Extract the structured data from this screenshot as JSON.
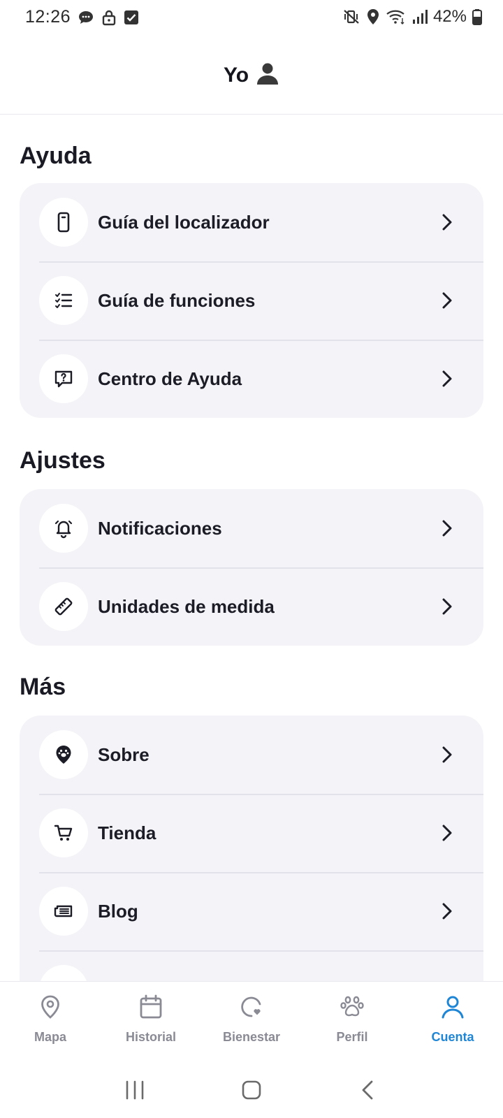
{
  "status_bar": {
    "time": "12:26",
    "battery_percent": "42%",
    "icons_left": [
      "chat-icon",
      "lock-icon",
      "check-box-icon"
    ],
    "icons_right": [
      "mute-vibrate-icon",
      "location-icon",
      "wifi-icon",
      "signal-icon",
      "battery-icon"
    ]
  },
  "header": {
    "title": "Yo",
    "icon": "person-icon"
  },
  "sections": {
    "help": {
      "title": "Ayuda",
      "items": [
        {
          "label": "Guía del localizador",
          "icon": "device-icon"
        },
        {
          "label": "Guía de funciones",
          "icon": "checklist-icon"
        },
        {
          "label": "Centro de Ayuda",
          "icon": "help-chat-icon"
        }
      ]
    },
    "settings": {
      "title": "Ajustes",
      "items": [
        {
          "label": "Notificaciones",
          "icon": "bell-icon"
        },
        {
          "label": "Unidades de medida",
          "icon": "ruler-icon"
        }
      ]
    },
    "more": {
      "title": "Más",
      "items": [
        {
          "label": "Sobre",
          "icon": "paw-pin-icon"
        },
        {
          "label": "Tienda",
          "icon": "cart-icon"
        },
        {
          "label": "Blog",
          "icon": "newspaper-icon"
        }
      ]
    }
  },
  "bottom_nav": {
    "items": [
      {
        "label": "Mapa",
        "icon": "map-pin-icon"
      },
      {
        "label": "Historial",
        "icon": "calendar-icon"
      },
      {
        "label": "Bienestar",
        "icon": "wellness-icon"
      },
      {
        "label": "Perfil",
        "icon": "paw-icon"
      },
      {
        "label": "Cuenta",
        "icon": "account-icon"
      }
    ],
    "active": "Cuenta"
  },
  "colors": {
    "accent": "#1f86d6",
    "card_bg": "#f4f4f8",
    "text": "#1c1c26",
    "inactive": "#8a8a95"
  }
}
